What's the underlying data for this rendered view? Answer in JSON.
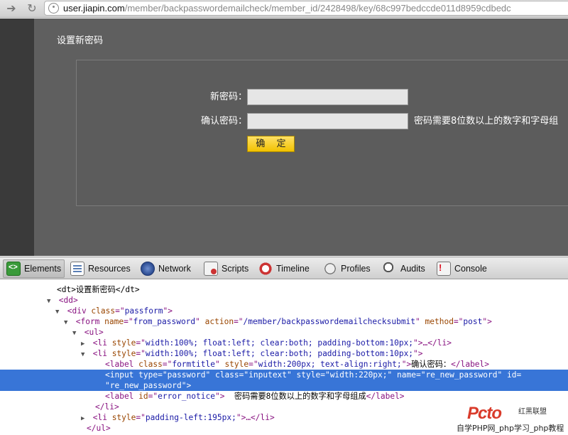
{
  "browser": {
    "url_host": "user.jiapin.com",
    "url_path": "/member/backpasswordemailcheck/member_id/2428498/key/68c997bedccde011d8959cdbedc"
  },
  "page": {
    "title": "设置新密码",
    "new_password_label": "新密码：",
    "confirm_password_label": "确认密码：",
    "error_notice": "密码需要8位数以上的数字和字母组",
    "submit_label": "确 定"
  },
  "devtools": {
    "tabs": [
      "Elements",
      "Resources",
      "Network",
      "Scripts",
      "Timeline",
      "Profiles",
      "Audits",
      "Console"
    ],
    "active_tab": "Elements",
    "lines": [
      {
        "indent": 80,
        "tri": "",
        "html": "<span class=\"tx\">&lt;dt&gt;设置新密码&lt;/dt&gt;</span>"
      },
      {
        "indent": 78,
        "tri": "▼",
        "html": "&lt;dd&gt;"
      },
      {
        "indent": 90,
        "tri": "▼",
        "html": "&lt;div <span class=\"an\">class</span>=\"<span class=\"av\">passform</span>\"&gt;"
      },
      {
        "indent": 102,
        "tri": "▼",
        "html": "&lt;form <span class=\"an\">name</span>=\"<span class=\"av\">from_password</span>\" <span class=\"an\">action</span>=\"<span class=\"av\">/member/backpasswordemailchecksubmit</span>\" <span class=\"an\">method</span>=\"<span class=\"av\">post</span>\"&gt;"
      },
      {
        "indent": 114,
        "tri": "▼",
        "html": "&lt;ul&gt;"
      },
      {
        "indent": 126,
        "tri": "▶",
        "html": "&lt;li <span class=\"an\">style</span>=\"<span class=\"av\">width:100%; float:left; clear:both; padding-bottom:10px;</span>\"&gt;…&lt;/li&gt;"
      },
      {
        "indent": 126,
        "tri": "▼",
        "html": "&lt;li <span class=\"an\">style</span>=\"<span class=\"av\">width:100%; float:left; clear:both; padding-bottom:10px;</span>\"&gt;"
      },
      {
        "indent": 148,
        "tri": "",
        "html": "&lt;label <span class=\"an\">class</span>=\"<span class=\"av\">formtitle</span>\" <span class=\"an\">style</span>=\"<span class=\"av\">width:200px; text-align:right;</span>\"&gt;<span class=\"tx\">确认密码：</span>&lt;/label&gt;"
      },
      {
        "indent": 148,
        "tri": "",
        "selected": true,
        "html": "&lt;input <span class=\"an\">type</span>=\"<span class=\"av\">password</span>\" <span class=\"an\">class</span>=\"<span class=\"av\">inputext</span>\" <span class=\"an\">style</span>=\"<span class=\"av\">width:220px;</span>\" <span class=\"an\">name</span>=\"<span class=\"av\">re_new_password</span>\" <span class=\"an\">id</span>="
      },
      {
        "indent": 148,
        "tri": "",
        "selected": true,
        "html": "\"<span class=\"av\">re_new_password</span>\"&gt;"
      },
      {
        "indent": 148,
        "tri": "",
        "html": "&lt;label <span class=\"an\">id</span>=\"<span class=\"av\">error_notice</span>\"&gt;  <span class=\"tx\">密码需要8位数以上的数字和字母组成</span>&lt;/label&gt;"
      },
      {
        "indent": 134,
        "tri": "",
        "html": "&lt;/li&gt;"
      },
      {
        "indent": 126,
        "tri": "▶",
        "html": "&lt;li <span class=\"an\">style</span>=\"<span class=\"av\">padding-left:195px;</span>\"&gt;…&lt;/li&gt;"
      },
      {
        "indent": 122,
        "tri": "",
        "html": "&lt;/ul&gt;"
      }
    ]
  },
  "watermark": {
    "logo": "Pcto",
    "logo_cn": "红黑联盟",
    "text": "自学PHP网_php学习_php教程"
  }
}
